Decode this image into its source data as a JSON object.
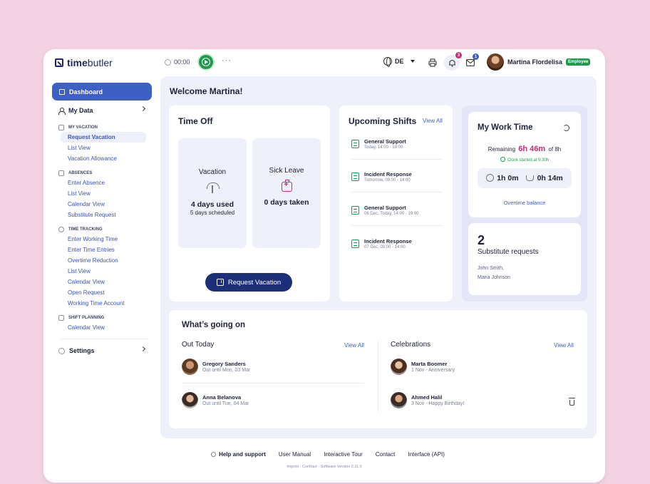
{
  "app": {
    "logo_bold": "time",
    "logo_light": "butler"
  },
  "topbar": {
    "timer": "00:00",
    "more": "···",
    "language": "DE",
    "notifications_count": "3",
    "messages_count": "1",
    "user_name": "Martina Flordelisa",
    "user_role": "Employee",
    "colors": {
      "accent": "#3e5fc4",
      "success": "#1f9a4f",
      "highlight": "#c8297a",
      "primary_dark": "#1c2f78"
    }
  },
  "sidebar": {
    "dashboard": "Dashboard",
    "my_data": "My Data",
    "sections": [
      {
        "title": "MY VACATION",
        "items": [
          "Request Vacation",
          "List View",
          "Vacation Allowance"
        ]
      },
      {
        "title": "ABSENCES",
        "items": [
          "Enter Absence",
          "List View",
          "Calendar View",
          "Substitute Request"
        ]
      },
      {
        "title": "TIME TRACKING",
        "items": [
          "Enter Working Time",
          "Enter Time Entries",
          "Overtime Reduction",
          "List View",
          "Calendar View",
          "Open Request",
          "Working Time Account"
        ]
      },
      {
        "title": "SHIFT PLANNING",
        "items": [
          "Calendar View"
        ]
      }
    ],
    "settings": "Settings"
  },
  "main": {
    "welcome": "Welcome Martina!",
    "time_off": {
      "title": "Time Off",
      "vacation_label": "Vacation",
      "vacation_used": "4 days used",
      "vacation_scheduled": "5 days scheduled",
      "sick_label": "Sick Leave",
      "sick_taken": "0 days taken",
      "request_button": "Request Vacation"
    },
    "shifts": {
      "title": "Upcoming Shifts",
      "view_all": "View All",
      "items": [
        {
          "name": "General Support",
          "when": "Today, 14:00 - 19:00"
        },
        {
          "name": "Incident Response",
          "when": "Tomorrow, 09:00 - 14:00"
        },
        {
          "name": "General Support",
          "when": "06 Dec, Today, 14:00 - 19:00"
        },
        {
          "name": "Incident Response",
          "when": "07 Dec, 09:00 - 14:00"
        }
      ]
    },
    "work_time": {
      "title": "My Work Time",
      "remaining_label": "Remaining",
      "remaining_value": "6h 46m",
      "remaining_total": "of 8h",
      "clock_started": "Clock started at 9.30h",
      "worked": "1h 0m",
      "break": "0h 14m",
      "overtime_link": "Overtime balance"
    },
    "substitute": {
      "count": "2",
      "label": "Substitute requests",
      "names_line1": "John Smith,",
      "names_line2": "Maria Johnson"
    },
    "whats_going_on": {
      "title": "What’s going on",
      "out_today_title": "Out Today",
      "celebrations_title": "Celebrations",
      "view_all": "View All",
      "out_today": [
        {
          "name": "Gregory Sanders",
          "detail": "Out until Mon, 03 Mar"
        },
        {
          "name": "Anna Belanova",
          "detail": "Out until Tue, 04 Mar"
        }
      ],
      "celebrations": [
        {
          "name": "Marta Boomer",
          "detail": "1 Nov - Anniversary"
        },
        {
          "name": "Ahmed Halil",
          "detail": "3 Nov - Happy Birthday!"
        }
      ]
    }
  },
  "footer": {
    "help": "Help and support",
    "user_manual": "User Manual",
    "tour": "Interactive Tour",
    "contact": "Contact",
    "api": "Interface (API)",
    "fine": "Imprint  ·  Contract  ·  Software Version 2.11.0"
  }
}
